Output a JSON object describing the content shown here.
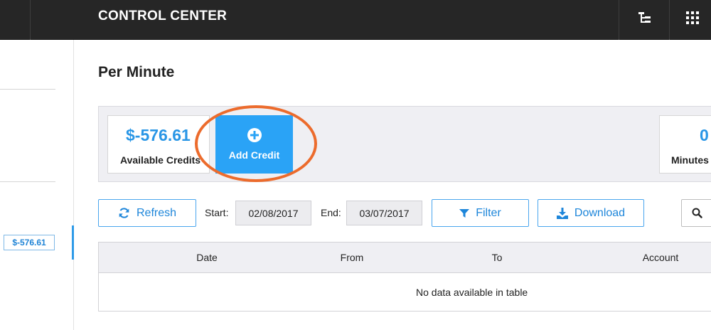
{
  "topbar": {
    "title": "CONTROL CENTER",
    "icons": [
      "hierarchy-icon",
      "app-grid-icon"
    ]
  },
  "sidebar": {
    "credit_badge": "$-576.61"
  },
  "page": {
    "title": "Per Minute"
  },
  "summary": {
    "credits_value": "$-576.61",
    "credits_label": "Available Credits",
    "add_credit_label": "Add Credit",
    "minutes_value": "0",
    "minutes_label": "Minutes"
  },
  "toolbar": {
    "refresh_label": "Refresh",
    "start_label": "Start:",
    "start_value": "02/08/2017",
    "end_label": "End:",
    "end_value": "03/07/2017",
    "filter_label": "Filter",
    "download_label": "Download"
  },
  "table": {
    "columns": [
      "Date",
      "From",
      "To",
      "Account"
    ],
    "empty_message": "No data available in table"
  },
  "colors": {
    "accent": "#2aa3f6",
    "highlight": "#ec6b2c",
    "topbar": "#262626"
  }
}
